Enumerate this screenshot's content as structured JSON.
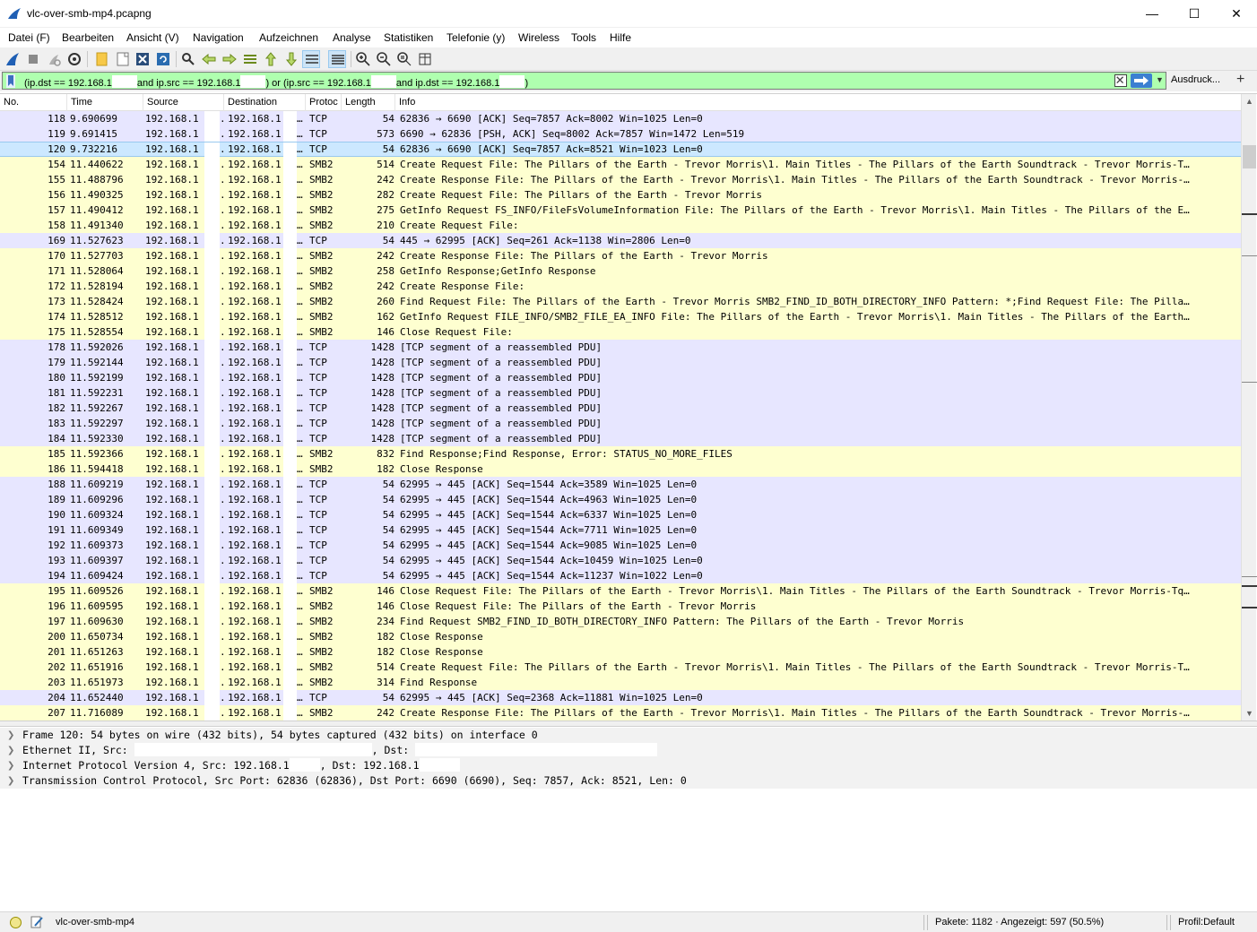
{
  "window": {
    "title": "vlc-over-smb-mp4.pcapng",
    "minimize": "—",
    "maximize": "☐",
    "close": "✕"
  },
  "menu": [
    {
      "label": "Datei (F)",
      "name": "menu-datei"
    },
    {
      "label": "Bearbeiten",
      "name": "menu-bearbeiten"
    },
    {
      "label": "Ansicht (V)",
      "name": "menu-ansicht"
    },
    {
      "label": "Navigation",
      "name": "menu-navigation"
    },
    {
      "label": "Aufzeichnen",
      "name": "menu-aufzeichnen"
    },
    {
      "label": "Analyse",
      "name": "menu-analyse"
    },
    {
      "label": "Statistiken",
      "name": "menu-statistiken"
    },
    {
      "label": "Telefonie (y)",
      "name": "menu-telefonie"
    },
    {
      "label": "Wireless",
      "name": "menu-wireless"
    },
    {
      "label": "Tools",
      "name": "menu-tools"
    },
    {
      "label": "Hilfe",
      "name": "menu-hilfe"
    }
  ],
  "toolbar_icons": [
    "shark-fin-start-icon",
    "stop-capture-icon",
    "restart-capture-icon",
    "capture-options-icon",
    "open-file-icon",
    "save-file-icon",
    "close-file-icon",
    "reload-file-icon",
    "find-packet-icon",
    "go-back-icon",
    "go-forward-icon",
    "go-to-packet-icon",
    "first-packet-icon",
    "last-packet-icon",
    "autoscroll-icon",
    "colorize-icon",
    "zoom-in-icon",
    "zoom-out-icon",
    "zoom-normal-icon",
    "resize-columns-icon"
  ],
  "filter": {
    "part1": "(ip.dst == 192.168.1",
    "part2": "and ip.src == 192.168.1",
    "part3": ") or (ip.src == 192.168.1",
    "part4": "and ip.dst == 192.168.1",
    "part5": ")",
    "expression_label": "Ausdruck...",
    "add_label": "+",
    "dropdown": "▼",
    "bg_color": "#afffaf"
  },
  "columns": [
    "No.",
    "Time",
    "Source",
    "Destination",
    "Protoc",
    "Length",
    "Info"
  ],
  "colors": {
    "tcp": "#e7e6ff",
    "smb": "#feffd0",
    "selected": "#cce8ff"
  },
  "packets": [
    {
      "no": "118",
      "time": "9.690699",
      "src": "192.168.1",
      "dst": "192.168.1",
      "proto": "TCP",
      "len": "54",
      "info": "62836 → 6690 [ACK] Seq=7857 Ack=8002 Win=1025 Len=0",
      "kind": "tcp"
    },
    {
      "no": "119",
      "time": "9.691415",
      "src": "192.168.1",
      "dst": "192.168.1",
      "proto": "TCP",
      "len": "573",
      "info": "6690 → 62836 [PSH, ACK] Seq=8002 Ack=7857 Win=1472 Len=519",
      "kind": "tcp"
    },
    {
      "no": "120",
      "time": "9.732216",
      "src": "192.168.1",
      "dst": "192.168.1",
      "proto": "TCP",
      "len": "54",
      "info": "62836 → 6690 [ACK] Seq=7857 Ack=8521 Win=1023 Len=0",
      "kind": "sel"
    },
    {
      "no": "154",
      "time": "11.440622",
      "src": "192.168.1",
      "dst": "192.168.1",
      "proto": "SMB2",
      "len": "514",
      "info": "Create Request File: The Pillars of the Earth - Trevor Morris\\1. Main Titles - The Pillars of the Earth Soundtrack - Trevor Morris-T…",
      "kind": "smb"
    },
    {
      "no": "155",
      "time": "11.488796",
      "src": "192.168.1",
      "dst": "192.168.1",
      "proto": "SMB2",
      "len": "242",
      "info": "Create Response File: The Pillars of the Earth - Trevor Morris\\1. Main Titles - The Pillars of the Earth Soundtrack - Trevor Morris-…",
      "kind": "smb"
    },
    {
      "no": "156",
      "time": "11.490325",
      "src": "192.168.1",
      "dst": "192.168.1",
      "proto": "SMB2",
      "len": "282",
      "info": "Create Request File: The Pillars of the Earth - Trevor Morris",
      "kind": "smb"
    },
    {
      "no": "157",
      "time": "11.490412",
      "src": "192.168.1",
      "dst": "192.168.1",
      "proto": "SMB2",
      "len": "275",
      "info": "GetInfo Request FS_INFO/FileFsVolumeInformation File: The Pillars of the Earth - Trevor Morris\\1. Main Titles - The Pillars of the E…",
      "kind": "smb"
    },
    {
      "no": "158",
      "time": "11.491340",
      "src": "192.168.1",
      "dst": "192.168.1",
      "proto": "SMB2",
      "len": "210",
      "info": "Create Request File:",
      "kind": "smb"
    },
    {
      "no": "169",
      "time": "11.527623",
      "src": "192.168.1",
      "dst": "192.168.1",
      "proto": "TCP",
      "len": "54",
      "info": "445 → 62995 [ACK] Seq=261 Ack=1138 Win=2806 Len=0",
      "kind": "tcp"
    },
    {
      "no": "170",
      "time": "11.527703",
      "src": "192.168.1",
      "dst": "192.168.1",
      "proto": "SMB2",
      "len": "242",
      "info": "Create Response File: The Pillars of the Earth - Trevor Morris",
      "kind": "smb"
    },
    {
      "no": "171",
      "time": "11.528064",
      "src": "192.168.1",
      "dst": "192.168.1",
      "proto": "SMB2",
      "len": "258",
      "info": "GetInfo Response;GetInfo Response",
      "kind": "smb"
    },
    {
      "no": "172",
      "time": "11.528194",
      "src": "192.168.1",
      "dst": "192.168.1",
      "proto": "SMB2",
      "len": "242",
      "info": "Create Response File:",
      "kind": "smb"
    },
    {
      "no": "173",
      "time": "11.528424",
      "src": "192.168.1",
      "dst": "192.168.1",
      "proto": "SMB2",
      "len": "260",
      "info": "Find Request File: The Pillars of the Earth - Trevor Morris SMB2_FIND_ID_BOTH_DIRECTORY_INFO Pattern: *;Find Request File: The Pilla…",
      "kind": "smb"
    },
    {
      "no": "174",
      "time": "11.528512",
      "src": "192.168.1",
      "dst": "192.168.1",
      "proto": "SMB2",
      "len": "162",
      "info": "GetInfo Request FILE_INFO/SMB2_FILE_EA_INFO File: The Pillars of the Earth - Trevor Morris\\1. Main Titles - The Pillars of the Earth…",
      "kind": "smb"
    },
    {
      "no": "175",
      "time": "11.528554",
      "src": "192.168.1",
      "dst": "192.168.1",
      "proto": "SMB2",
      "len": "146",
      "info": "Close Request File:",
      "kind": "smb"
    },
    {
      "no": "178",
      "time": "11.592026",
      "src": "192.168.1",
      "dst": "192.168.1",
      "proto": "TCP",
      "len": "1428",
      "info": "[TCP segment of a reassembled PDU]",
      "kind": "tcp"
    },
    {
      "no": "179",
      "time": "11.592144",
      "src": "192.168.1",
      "dst": "192.168.1",
      "proto": "TCP",
      "len": "1428",
      "info": "[TCP segment of a reassembled PDU]",
      "kind": "tcp"
    },
    {
      "no": "180",
      "time": "11.592199",
      "src": "192.168.1",
      "dst": "192.168.1",
      "proto": "TCP",
      "len": "1428",
      "info": "[TCP segment of a reassembled PDU]",
      "kind": "tcp"
    },
    {
      "no": "181",
      "time": "11.592231",
      "src": "192.168.1",
      "dst": "192.168.1",
      "proto": "TCP",
      "len": "1428",
      "info": "[TCP segment of a reassembled PDU]",
      "kind": "tcp"
    },
    {
      "no": "182",
      "time": "11.592267",
      "src": "192.168.1",
      "dst": "192.168.1",
      "proto": "TCP",
      "len": "1428",
      "info": "[TCP segment of a reassembled PDU]",
      "kind": "tcp"
    },
    {
      "no": "183",
      "time": "11.592297",
      "src": "192.168.1",
      "dst": "192.168.1",
      "proto": "TCP",
      "len": "1428",
      "info": "[TCP segment of a reassembled PDU]",
      "kind": "tcp"
    },
    {
      "no": "184",
      "time": "11.592330",
      "src": "192.168.1",
      "dst": "192.168.1",
      "proto": "TCP",
      "len": "1428",
      "info": "[TCP segment of a reassembled PDU]",
      "kind": "tcp"
    },
    {
      "no": "185",
      "time": "11.592366",
      "src": "192.168.1",
      "dst": "192.168.1",
      "proto": "SMB2",
      "len": "832",
      "info": "Find Response;Find Response, Error: STATUS_NO_MORE_FILES",
      "kind": "smb"
    },
    {
      "no": "186",
      "time": "11.594418",
      "src": "192.168.1",
      "dst": "192.168.1",
      "proto": "SMB2",
      "len": "182",
      "info": "Close Response",
      "kind": "smb"
    },
    {
      "no": "188",
      "time": "11.609219",
      "src": "192.168.1",
      "dst": "192.168.1",
      "proto": "TCP",
      "len": "54",
      "info": "62995 → 445 [ACK] Seq=1544 Ack=3589 Win=1025 Len=0",
      "kind": "tcp"
    },
    {
      "no": "189",
      "time": "11.609296",
      "src": "192.168.1",
      "dst": "192.168.1",
      "proto": "TCP",
      "len": "54",
      "info": "62995 → 445 [ACK] Seq=1544 Ack=4963 Win=1025 Len=0",
      "kind": "tcp"
    },
    {
      "no": "190",
      "time": "11.609324",
      "src": "192.168.1",
      "dst": "192.168.1",
      "proto": "TCP",
      "len": "54",
      "info": "62995 → 445 [ACK] Seq=1544 Ack=6337 Win=1025 Len=0",
      "kind": "tcp"
    },
    {
      "no": "191",
      "time": "11.609349",
      "src": "192.168.1",
      "dst": "192.168.1",
      "proto": "TCP",
      "len": "54",
      "info": "62995 → 445 [ACK] Seq=1544 Ack=7711 Win=1025 Len=0",
      "kind": "tcp"
    },
    {
      "no": "192",
      "time": "11.609373",
      "src": "192.168.1",
      "dst": "192.168.1",
      "proto": "TCP",
      "len": "54",
      "info": "62995 → 445 [ACK] Seq=1544 Ack=9085 Win=1025 Len=0",
      "kind": "tcp"
    },
    {
      "no": "193",
      "time": "11.609397",
      "src": "192.168.1",
      "dst": "192.168.1",
      "proto": "TCP",
      "len": "54",
      "info": "62995 → 445 [ACK] Seq=1544 Ack=10459 Win=1025 Len=0",
      "kind": "tcp"
    },
    {
      "no": "194",
      "time": "11.609424",
      "src": "192.168.1",
      "dst": "192.168.1",
      "proto": "TCP",
      "len": "54",
      "info": "62995 → 445 [ACK] Seq=1544 Ack=11237 Win=1022 Len=0",
      "kind": "tcp"
    },
    {
      "no": "195",
      "time": "11.609526",
      "src": "192.168.1",
      "dst": "192.168.1",
      "proto": "SMB2",
      "len": "146",
      "info": "Close Request File: The Pillars of the Earth - Trevor Morris\\1. Main Titles - The Pillars of the Earth Soundtrack - Trevor Morris-Tq…",
      "kind": "smb"
    },
    {
      "no": "196",
      "time": "11.609595",
      "src": "192.168.1",
      "dst": "192.168.1",
      "proto": "SMB2",
      "len": "146",
      "info": "Close Request File: The Pillars of the Earth - Trevor Morris",
      "kind": "smb"
    },
    {
      "no": "197",
      "time": "11.609630",
      "src": "192.168.1",
      "dst": "192.168.1",
      "proto": "SMB2",
      "len": "234",
      "info": "Find Request SMB2_FIND_ID_BOTH_DIRECTORY_INFO Pattern: The Pillars of the Earth - Trevor Morris",
      "kind": "smb"
    },
    {
      "no": "200",
      "time": "11.650734",
      "src": "192.168.1",
      "dst": "192.168.1",
      "proto": "SMB2",
      "len": "182",
      "info": "Close Response",
      "kind": "smb"
    },
    {
      "no": "201",
      "time": "11.651263",
      "src": "192.168.1",
      "dst": "192.168.1",
      "proto": "SMB2",
      "len": "182",
      "info": "Close Response",
      "kind": "smb"
    },
    {
      "no": "202",
      "time": "11.651916",
      "src": "192.168.1",
      "dst": "192.168.1",
      "proto": "SMB2",
      "len": "514",
      "info": "Create Request File: The Pillars of the Earth - Trevor Morris\\1. Main Titles - The Pillars of the Earth Soundtrack - Trevor Morris-T…",
      "kind": "smb"
    },
    {
      "no": "203",
      "time": "11.651973",
      "src": "192.168.1",
      "dst": "192.168.1",
      "proto": "SMB2",
      "len": "314",
      "info": "Find Response",
      "kind": "smb"
    },
    {
      "no": "204",
      "time": "11.652440",
      "src": "192.168.1",
      "dst": "192.168.1",
      "proto": "TCP",
      "len": "54",
      "info": "62995 → 445 [ACK] Seq=2368 Ack=11881 Win=1025 Len=0",
      "kind": "tcp"
    },
    {
      "no": "207",
      "time": "11.716089",
      "src": "192.168.1",
      "dst": "192.168.1",
      "proto": "SMB2",
      "len": "242",
      "info": "Create Response File: The Pillars of the Earth - Trevor Morris\\1. Main Titles - The Pillars of the Earth Soundtrack - Trevor Morris-…",
      "kind": "smb"
    }
  ],
  "details": [
    {
      "a": "Frame 120: 54 bytes on wire (432 bits), 54 bytes captured (432 bits) on interface 0",
      "b": "",
      "c": ""
    },
    {
      "a": "Ethernet II, Src: ",
      "b": ", Dst: ",
      "c": ""
    },
    {
      "a": "Internet Protocol Version 4, Src: 192.168.1",
      "b": ", Dst: 192.168.1",
      "c": ""
    },
    {
      "a": "Transmission Control Protocol, Src Port: 62836 (62836), Dst Port: 6690 (6690), Seq: 7857, Ack: 8521, Len: 0",
      "b": "",
      "c": ""
    }
  ],
  "status": {
    "file": "vlc-over-smb-mp4",
    "packets": "Pakete: 1182 · Angezeigt: 597 (50.5%)",
    "profile": "Profil:Default"
  }
}
